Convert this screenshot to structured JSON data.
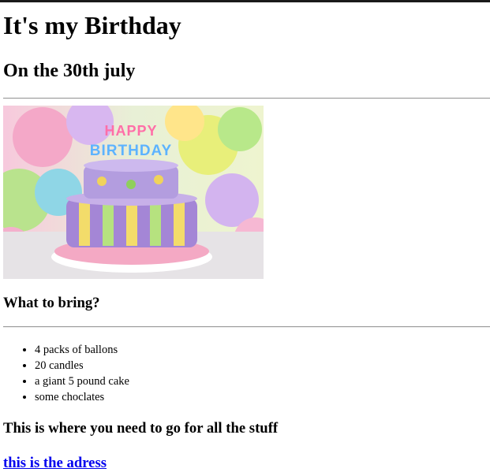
{
  "heading": "It's my Birthday",
  "date": "On the 30th july",
  "bring_heading": "What to bring?",
  "items": [
    "4 packs of ballons",
    "20 candles",
    "a giant 5 pound cake",
    "some choclates"
  ],
  "where_heading": "This is where you need to go for all the stuff",
  "address_link": "this is the adress",
  "cake_text": "HAPPY BIRTHDAY"
}
